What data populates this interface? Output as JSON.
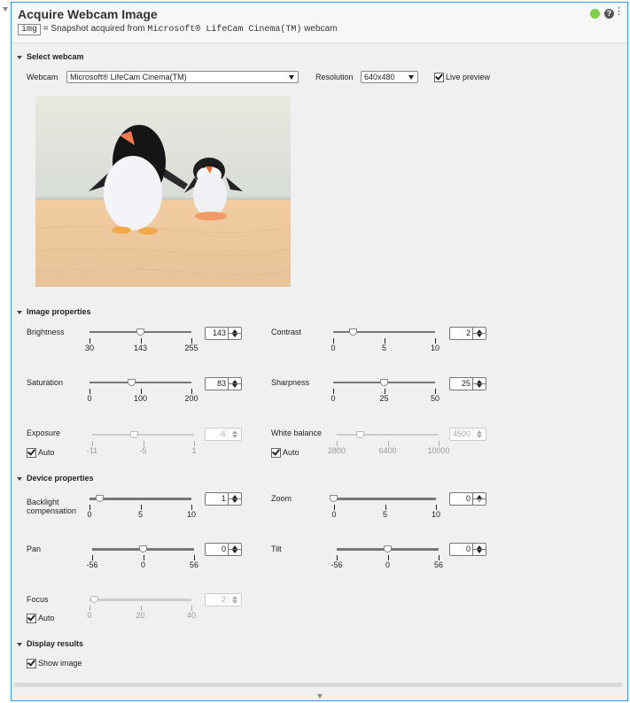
{
  "task": {
    "title": "Acquire Webcam Image",
    "output_var": "img",
    "subtitle_eq": "=",
    "subtitle_pre": "Snapshot acquired from",
    "subtitle_device": "Microsoft® LifeCam Cinema(TM)",
    "subtitle_post": "webcam",
    "status_color": "#7ed04b",
    "help_glyph": "?",
    "more_glyph": "⋮"
  },
  "select_webcam": {
    "heading": "Select webcam",
    "webcam_label": "Webcam",
    "webcam_value": "Microsoft® LifeCam Cinema(TM)",
    "resolution_label": "Resolution",
    "resolution_value": "640x480",
    "live_preview_label": "Live preview",
    "live_preview_checked": true
  },
  "image_properties": {
    "heading": "Image properties",
    "brightness": {
      "label": "Brightness",
      "value": "143",
      "min": 30,
      "max": 255,
      "ticks": [
        "30",
        "143",
        "255"
      ]
    },
    "contrast": {
      "label": "Contrast",
      "value": "2",
      "min": 0,
      "max": 10,
      "ticks": [
        "0",
        "5",
        "10"
      ]
    },
    "saturation": {
      "label": "Saturation",
      "value": "83",
      "min": 0,
      "max": 200,
      "ticks": [
        "0",
        "100",
        "200"
      ]
    },
    "sharpness": {
      "label": "Sharpness",
      "value": "25",
      "min": 0,
      "max": 50,
      "ticks": [
        "0",
        "25",
        "50"
      ]
    },
    "exposure": {
      "label": "Exposure",
      "value": "-6",
      "min": -11,
      "max": 1,
      "ticks": [
        "-11",
        "-5",
        "1"
      ],
      "auto_label": "Auto",
      "auto": true
    },
    "white_balance": {
      "label": "White balance",
      "value": "4500",
      "min": 2800,
      "max": 10000,
      "ticks": [
        "2800",
        "6400",
        "10000"
      ],
      "auto_label": "Auto",
      "auto": true
    }
  },
  "device_properties": {
    "heading": "Device properties",
    "backlight": {
      "label_line1": "Backlight",
      "label_line2": "compensation",
      "value": "1",
      "min": 0,
      "max": 10,
      "ticks": [
        "0",
        "5",
        "10"
      ]
    },
    "zoom": {
      "label": "Zoom",
      "value": "0",
      "min": 0,
      "max": 10,
      "ticks": [
        "0",
        "5",
        "10"
      ]
    },
    "pan": {
      "label": "Pan",
      "value": "0",
      "min": -56,
      "max": 56,
      "ticks": [
        "-56",
        "0",
        "56"
      ]
    },
    "tilt": {
      "label": "Tilt",
      "value": "0",
      "min": -56,
      "max": 56,
      "ticks": [
        "-56",
        "0",
        "56"
      ]
    },
    "focus": {
      "label": "Focus",
      "value": "2",
      "min": 0,
      "max": 40,
      "ticks": [
        "0",
        "20",
        "40"
      ],
      "auto_label": "Auto",
      "auto": true
    }
  },
  "display_results": {
    "heading": "Display results",
    "show_image_label": "Show image",
    "show_image_checked": true
  }
}
